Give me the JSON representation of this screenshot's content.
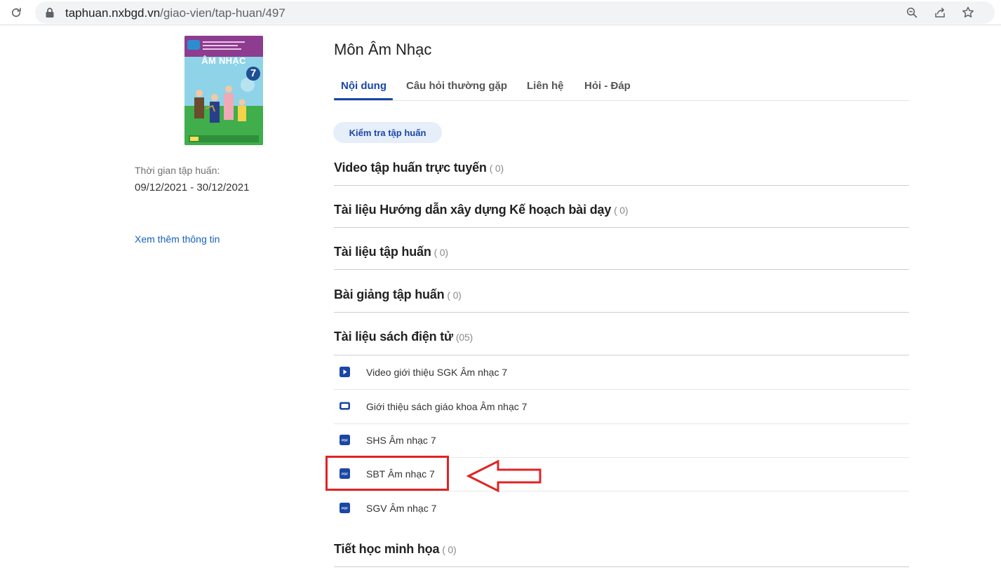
{
  "browser": {
    "url_domain": "taphuan.nxbgd.vn",
    "url_path": "/giao-vien/tap-huan/497",
    "icons": [
      "reload-icon",
      "lock-icon",
      "zoom-icon",
      "share-icon",
      "bookmark-star-icon"
    ]
  },
  "sidebar": {
    "cover": {
      "title": "ÂM NHẠC",
      "grade": "7",
      "color": "#3dba78"
    },
    "training_time_label": "Thời gian tập huấn:",
    "training_time_value": "09/12/2021 - 30/12/2021",
    "more_info_link": "Xem thêm thông tin"
  },
  "main": {
    "title": "Môn Âm Nhạc",
    "tabs": [
      {
        "label": "Nội dung",
        "active": true
      },
      {
        "label": "Câu hỏi thường gặp",
        "active": false
      },
      {
        "label": "Liên hệ",
        "active": false
      },
      {
        "label": "Hỏi - Đáp",
        "active": false
      }
    ],
    "check_button": "Kiểm tra tập huấn",
    "sections": [
      {
        "title": "Video tập huấn trực tuyến",
        "count": "( 0)"
      },
      {
        "title": "Tài liệu Hướng dẫn xây dựng Kế hoạch bài dạy",
        "count": "( 0)"
      },
      {
        "title": "Tài liệu tập huấn",
        "count": "( 0)"
      },
      {
        "title": "Bài giảng tập huấn",
        "count": "( 0)"
      },
      {
        "title": "Tài liệu sách điện tử",
        "count": "(05)"
      },
      {
        "title": "Tiết học minh họa",
        "count": "( 0)"
      }
    ],
    "documents": [
      {
        "label": "Video giới thiệu SGK Âm nhạc 7",
        "icon": "video-play-icon"
      },
      {
        "label": "Giới thiệu sách giáo khoa Âm nhạc 7",
        "icon": "slide-icon"
      },
      {
        "label": "SHS Âm nhạc 7",
        "icon": "pdf-icon"
      },
      {
        "label": "SBT Âm nhạc 7",
        "icon": "pdf-icon",
        "highlighted": true
      },
      {
        "label": "SGV Âm nhạc 7",
        "icon": "pdf-icon"
      }
    ],
    "pdf_icon_text": "PDF"
  },
  "colors": {
    "accent": "#1a47a6",
    "highlight": "#e02424",
    "link": "#1560bd"
  }
}
